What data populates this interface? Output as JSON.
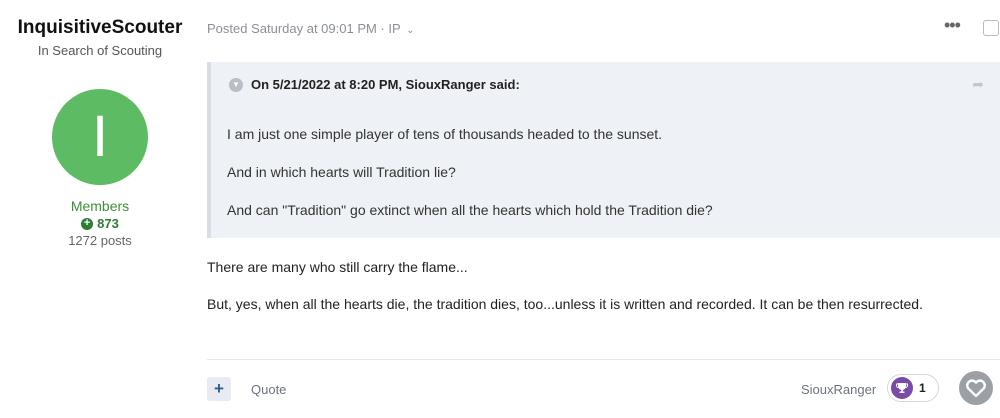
{
  "author": {
    "name": "InquisitiveScouter",
    "title": "In Search of Scouting",
    "avatar_letter": "I",
    "avatar_color": "#5dbb63",
    "group": "Members",
    "reputation": "873",
    "posts": "1272 posts"
  },
  "post": {
    "meta": "Posted Saturday at 09:01 PM · IP",
    "quote": {
      "citation": "On 5/21/2022 at 8:20 PM, SiouxRanger said:",
      "lines": [
        "I am just one simple player of tens of thousands headed to the sunset.",
        "And in which hearts will Tradition lie?",
        "And can \"Tradition\" go extinct when all the hearts which hold the Tradition die?"
      ]
    },
    "body": [
      "There are many who still carry the flame...",
      "But, yes, when all the hearts die, the tradition dies, too...unless it is written and recorded.  It can be then resurrected."
    ]
  },
  "footer": {
    "multiquote": "+",
    "quote_label": "Quote",
    "reactor_name": "SiouxRanger",
    "reaction_count": "1"
  },
  "icons": {
    "menu": "ellipsis-icon",
    "select": "checkbox-icon",
    "quote_toggle": "chevron-down-icon",
    "share": "share-arrow-icon",
    "reaction": "trophy-icon",
    "react": "heart-icon"
  }
}
